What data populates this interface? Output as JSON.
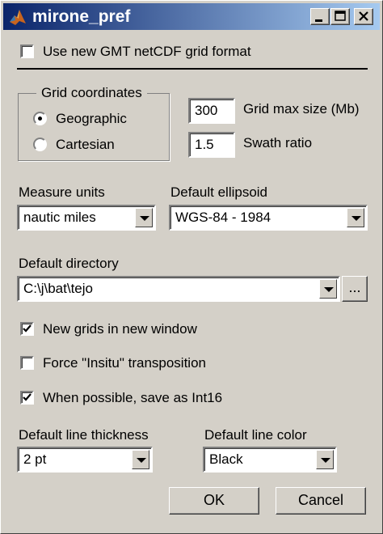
{
  "window": {
    "title": "mirone_pref"
  },
  "options": {
    "netcdf_label": "Use new GMT netCDF grid format",
    "netcdf_checked": false,
    "new_window_label": "New grids in new window",
    "new_window_checked": true,
    "insitu_label": "Force \"Insitu\" transposition",
    "insitu_checked": false,
    "int16_label": "When possible, save as Int16",
    "int16_checked": true
  },
  "grid_coords": {
    "title": "Grid coordinates",
    "geographic_label": "Geographic",
    "cartesian_label": "Cartesian",
    "selected": "Geographic"
  },
  "grid_size": {
    "value": "300",
    "label": "Grid max size (Mb)"
  },
  "swath": {
    "value": "1.5",
    "label": "Swath ratio"
  },
  "measure_units": {
    "label": "Measure units",
    "value": "nautic miles"
  },
  "ellipsoid": {
    "label": "Default ellipsoid",
    "value": "WGS-84 - 1984"
  },
  "directory": {
    "label": "Default directory",
    "value": "C:\\j\\bat\\tejo",
    "browse_label": "..."
  },
  "line_thickness": {
    "label": "Default line thickness",
    "value": "2 pt"
  },
  "line_color": {
    "label": "Default line color",
    "value": "Black"
  },
  "buttons": {
    "ok": "OK",
    "cancel": "Cancel"
  },
  "icons": {
    "app": "matlab-icon",
    "minimize": "minimize-icon",
    "maximize": "maximize-icon",
    "close": "close-icon",
    "check": "check-icon",
    "dropdown": "chevron-down-icon"
  }
}
